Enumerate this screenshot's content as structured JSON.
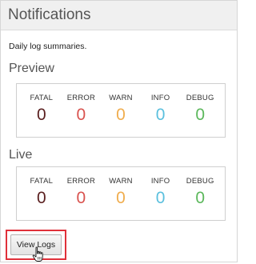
{
  "panel": {
    "title": "Notifications",
    "subtitle": "Daily log summaries."
  },
  "preview": {
    "title": "Preview",
    "stats": [
      {
        "label": "FATAL",
        "value": "0",
        "color": "#5a1f1f"
      },
      {
        "label": "ERROR",
        "value": "0",
        "color": "#d9534f"
      },
      {
        "label": "WARN",
        "value": "0",
        "color": "#f0ad4e"
      },
      {
        "label": "INFO",
        "value": "0",
        "color": "#5bc0de"
      },
      {
        "label": "DEBUG",
        "value": "0",
        "color": "#5cb85c"
      }
    ]
  },
  "live": {
    "title": "Live",
    "stats": [
      {
        "label": "FATAL",
        "value": "0",
        "color": "#5a1f1f"
      },
      {
        "label": "ERROR",
        "value": "0",
        "color": "#d9534f"
      },
      {
        "label": "WARN",
        "value": "0",
        "color": "#f0ad4e"
      },
      {
        "label": "INFO",
        "value": "0",
        "color": "#5bc0de"
      },
      {
        "label": "DEBUG",
        "value": "0",
        "color": "#5cb85c"
      }
    ]
  },
  "actions": {
    "view_logs_label": "View Logs",
    "highlight_color": "#e0303a"
  },
  "icons": {
    "cursor": "hand-pointer-icon"
  }
}
